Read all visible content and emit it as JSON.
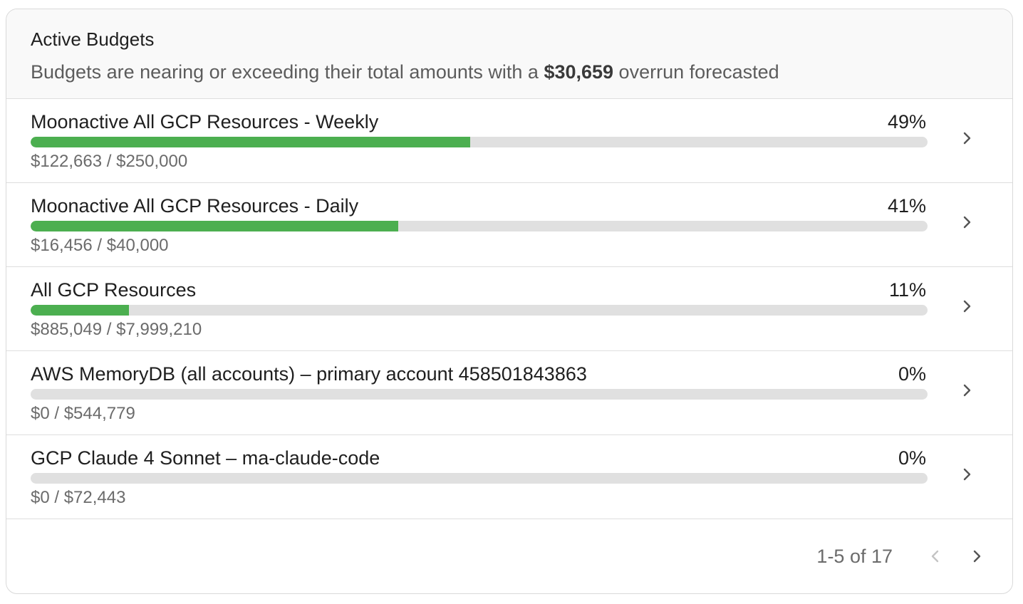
{
  "header": {
    "title": "Active Budgets",
    "subtitle_prefix": "Budgets are nearing or exceeding their total amounts with a ",
    "subtitle_amount": "$30,659",
    "subtitle_suffix": " overrun forecasted"
  },
  "budgets": [
    {
      "name": "Moonactive All GCP Resources - Weekly",
      "percent_label": "49%",
      "progress": 0.49,
      "amounts": "$122,663 / $250,000"
    },
    {
      "name": "Moonactive All GCP Resources - Daily",
      "percent_label": "41%",
      "progress": 0.41,
      "amounts": "$16,456 / $40,000"
    },
    {
      "name": "All GCP Resources",
      "percent_label": "11%",
      "progress": 0.11,
      "amounts": "$885,049 / $7,999,210"
    },
    {
      "name": "AWS MemoryDB (all accounts) – primary account 458501843863",
      "percent_label": "0%",
      "progress": 0,
      "amounts": "$0 / $544,779"
    },
    {
      "name": "GCP Claude 4 Sonnet – ma-claude-code",
      "percent_label": "0%",
      "progress": 0,
      "amounts": "$0 / $72,443"
    }
  ],
  "pagination": {
    "range_label": "1-5 of 17",
    "prev_icon": "chevron-left-icon",
    "next_icon": "chevron-right-icon"
  },
  "colors": {
    "progress_fill": "#4caf50",
    "progress_track": "#e0e0e0"
  }
}
